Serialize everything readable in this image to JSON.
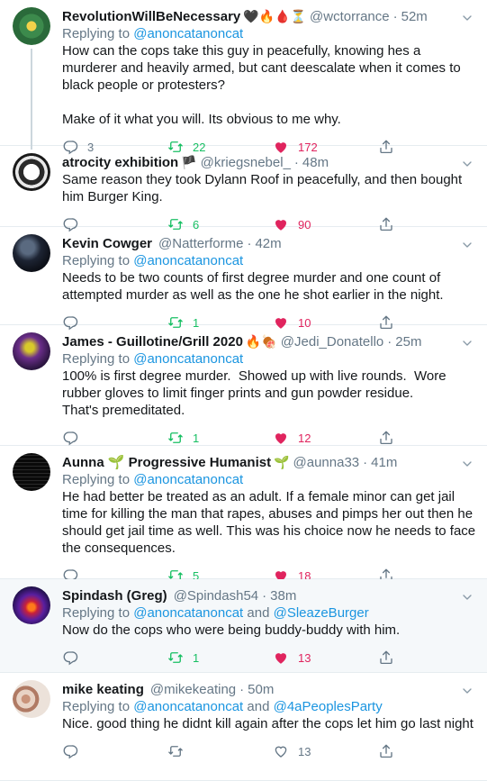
{
  "tweets": [
    {
      "name": "RevolutionWillBeNecessary",
      "emojis": "🖤🔥🩸⏳",
      "handle": "@wctorrance",
      "time": "52m",
      "replying_prefix": "Replying to ",
      "replying_to": [
        "@anoncatanoncat"
      ],
      "text": "How can the cops take this guy in peacefully, knowing hes a murderer and heavily armed, but cant deescalate when it comes to black people or protesters?\n\nMake of it what you will. Its obvious to me why.",
      "replies": "3",
      "retweets": "22",
      "likes": "172",
      "liked": true,
      "retweeted": true
    },
    {
      "name": "atrocity exhibition",
      "emojis": "🏴",
      "handle": "@kriegsnebel_",
      "time": "48m",
      "replying_prefix": "",
      "replying_to": [],
      "text": "Same reason they took Dylann Roof in peacefully, and then bought him Burger King.",
      "replies": "",
      "retweets": "6",
      "likes": "90",
      "liked": true,
      "retweeted": true
    },
    {
      "name": "Kevin Cowger",
      "emojis": "",
      "handle": "@Natterforme",
      "time": "42m",
      "replying_prefix": "Replying to ",
      "replying_to": [
        "@anoncatanoncat"
      ],
      "text": "Needs to be two counts of first degree murder and one count of attempted murder as well as the one he shot earlier in the night.",
      "replies": "",
      "retweets": "1",
      "likes": "10",
      "liked": true,
      "retweeted": true
    },
    {
      "name": "James - Guillotine/Grill 2020",
      "emojis": "🔥🍖",
      "handle": "@Jedi_Donatello",
      "time": "25m",
      "replying_prefix": "Replying to ",
      "replying_to": [
        "@anoncatanoncat"
      ],
      "text": "100% is first degree murder.  Showed up with live rounds.  Wore rubber gloves to limit finger prints and gun powder residue.\nThat's premeditated.",
      "replies": "",
      "retweets": "1",
      "likes": "12",
      "liked": true,
      "retweeted": true
    },
    {
      "name": "Aunna 🌱 Progressive Humanist",
      "emojis": "🌱",
      "handle": "@aunna33",
      "time": "41m",
      "replying_prefix": "Replying to ",
      "replying_to": [
        "@anoncatanoncat"
      ],
      "text": "He had better be treated as an adult. If a female minor can get jail time for killing the man that rapes, abuses and pimps her out then he should get jail time as well. This was his choice now he needs to face the consequences.",
      "replies": "",
      "retweets": "5",
      "likes": "18",
      "liked": true,
      "retweeted": true
    },
    {
      "name": "Spindash (Greg)",
      "emojis": "",
      "handle": "@Spindash54",
      "time": "38m",
      "replying_prefix": "Replying to ",
      "replying_to": [
        "@anoncatanoncat",
        "@SleazeBurger"
      ],
      "text": "Now do the cops who were being buddy-buddy with him.",
      "replies": "",
      "retweets": "1",
      "likes": "13",
      "liked": true,
      "retweeted": true
    },
    {
      "name": "mike keating",
      "emojis": "",
      "handle": "@mikekeating",
      "time": "50m",
      "replying_prefix": "Replying to ",
      "replying_to": [
        "@anoncatanoncat",
        "@4aPeoplesParty"
      ],
      "text": "Nice. good thing he didnt kill again after the cops let him go last night",
      "replies": "",
      "retweets": "",
      "likes": "13",
      "liked": false,
      "retweeted": false
    }
  ],
  "ui": {
    "and_word": "and",
    "dot": "·"
  },
  "colors": {
    "link": "#1b95e0",
    "retweet": "#17bf63",
    "like": "#e0245e",
    "muted": "#657786",
    "shaded_bg": "#f5f8fa"
  }
}
